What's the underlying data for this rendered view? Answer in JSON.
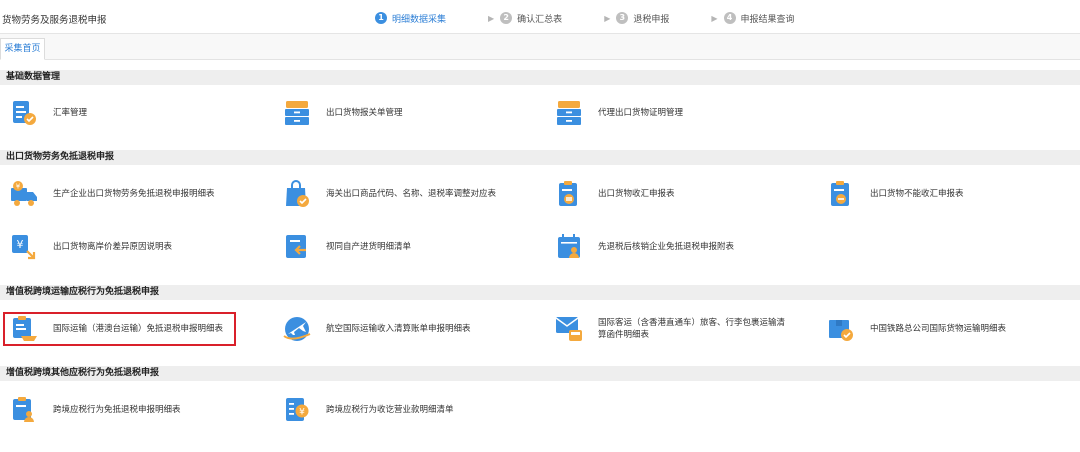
{
  "header": {
    "app_title": "货物劳务及服务退税申报",
    "steps": [
      {
        "num": "1",
        "label": "明细数据采集"
      },
      {
        "num": "2",
        "label": "确认汇总表"
      },
      {
        "num": "3",
        "label": "退税申报"
      },
      {
        "num": "4",
        "label": "申报结果查询"
      }
    ]
  },
  "tabs": [
    {
      "label": "采集首页"
    }
  ],
  "sections": [
    {
      "title": "基础数据管理"
    },
    {
      "title": "出口货物劳务免抵退税申报"
    },
    {
      "title": "增值税跨境运输应税行为免抵退税申报"
    },
    {
      "title": "增值税跨境其他应税行为免抵退税申报"
    }
  ],
  "items": {
    "exchange_rate": {
      "label": "汇率管理",
      "icon": "document-check-icon"
    },
    "customs_declaration": {
      "label": "出口货物报关单管理",
      "icon": "cabinet-icon"
    },
    "agent_certificate": {
      "label": "代理出口货物证明管理",
      "icon": "cabinet-icon"
    },
    "production_detail": {
      "label": "生产企业出口货物劳务免抵退税申报明细表",
      "icon": "truck-yen-icon"
    },
    "customs_codes": {
      "label": "海关出口商品代码、名称、退税率调整对应表",
      "icon": "shopping-bag-icon"
    },
    "receipt_report": {
      "label": "出口货物收汇申报表",
      "icon": "clipboard-exchange-icon"
    },
    "no_receipt_report": {
      "label": "出口货物不能收汇申报表",
      "icon": "clipboard-block-icon"
    },
    "price_difference": {
      "label": "出口货物离岸价差异原因说明表",
      "icon": "yen-doc-icon"
    },
    "self_produced": {
      "label": "视同自产进货明细清单",
      "icon": "doc-return-icon"
    },
    "pre_tax_refund": {
      "label": "先退税后核销企业免抵退税申报附表",
      "icon": "calendar-person-icon"
    },
    "intl_transport": {
      "label": "国际运输（港澳台运输）免抵退税申报明细表",
      "icon": "clipboard-ship-icon"
    },
    "aviation_income": {
      "label": "航空国际运输收入清算账单申报明细表",
      "icon": "airplane-icon"
    },
    "passenger_transport": {
      "label": "国际客运（含香港直通车）旅客、行李包裹运输清算函件明细表",
      "icon": "mail-bus-icon"
    },
    "railway_freight": {
      "label": "中国铁路总公司国际货物运输明细表",
      "icon": "box-check-icon"
    },
    "cross_border_detail": {
      "label": "跨境应税行为免抵退税申报明细表",
      "icon": "clipboard-person-icon"
    },
    "cross_border_income": {
      "label": "跨境应税行为收讫营业款明细清单",
      "icon": "yen-list-icon"
    }
  },
  "colors": {
    "accent_blue": "#3b8fe0",
    "accent_orange": "#f4a93e",
    "highlight_border": "#d9202a",
    "section_bg": "#eeeeee"
  }
}
